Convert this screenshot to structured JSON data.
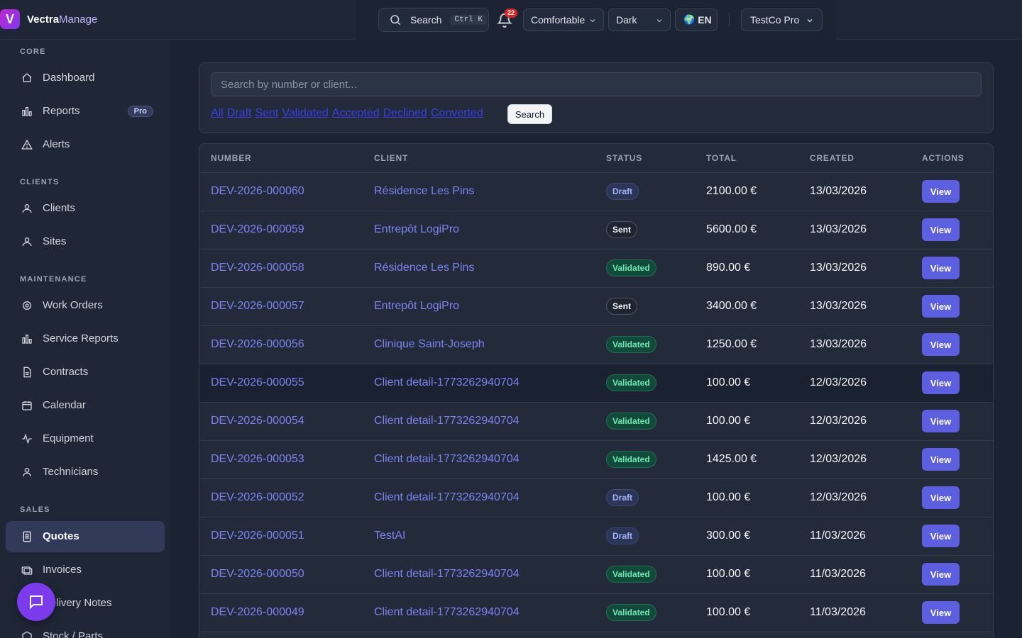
{
  "brand": {
    "logo_letter": "V",
    "name_a": "Vectra",
    "name_b": "Manage"
  },
  "topbar": {
    "search_label": "Search",
    "search_shortcut": "Ctrl K",
    "notifications_count": "22",
    "density": "Comfortable",
    "theme": "Dark",
    "language_flag": "🌍",
    "language": "EN",
    "organization": "TestCo Pro"
  },
  "sidebar": {
    "sections": [
      {
        "title": "CORE",
        "items": [
          {
            "label": "Dashboard",
            "icon": "home-icon"
          },
          {
            "label": "Reports",
            "icon": "bar-chart-icon",
            "badge": "Pro"
          },
          {
            "label": "Alerts",
            "icon": "alert-triangle-icon"
          }
        ]
      },
      {
        "title": "CLIENTS",
        "items": [
          {
            "label": "Clients",
            "icon": "users-icon"
          },
          {
            "label": "Sites",
            "icon": "users-icon"
          }
        ]
      },
      {
        "title": "MAINTENANCE",
        "items": [
          {
            "label": "Work Orders",
            "icon": "gear-icon"
          },
          {
            "label": "Service Reports",
            "icon": "bar-chart-icon"
          },
          {
            "label": "Contracts",
            "icon": "document-icon"
          },
          {
            "label": "Calendar",
            "icon": "calendar-icon"
          },
          {
            "label": "Equipment",
            "icon": "activity-icon"
          },
          {
            "label": "Technicians",
            "icon": "user-icon"
          }
        ]
      },
      {
        "title": "SALES",
        "items": [
          {
            "label": "Quotes",
            "icon": "receipt-icon",
            "active": true
          },
          {
            "label": "Invoices",
            "icon": "banknote-icon"
          },
          {
            "label": "Delivery Notes",
            "icon": "truck-icon"
          },
          {
            "label": "Stock / Parts",
            "icon": "box-icon"
          }
        ]
      }
    ]
  },
  "filters": {
    "placeholder": "Search by number or client...",
    "links": [
      "All",
      "Draft",
      "Sent",
      "Validated",
      "Accepted",
      "Declined",
      "Converted"
    ],
    "search_button": "Search"
  },
  "table": {
    "columns": [
      "NUMBER",
      "CLIENT",
      "STATUS",
      "TOTAL",
      "CREATED",
      "ACTIONS"
    ],
    "action_label": "View",
    "rows": [
      {
        "number": "DEV-2026-000060",
        "client": "Résidence Les Pins",
        "status": "Draft",
        "total": "2100.00 €",
        "created": "13/03/2026"
      },
      {
        "number": "DEV-2026-000059",
        "client": "Entrepôt LogiPro",
        "status": "Sent",
        "total": "5600.00 €",
        "created": "13/03/2026"
      },
      {
        "number": "DEV-2026-000058",
        "client": "Résidence Les Pins",
        "status": "Validated",
        "total": "890.00 €",
        "created": "13/03/2026"
      },
      {
        "number": "DEV-2026-000057",
        "client": "Entrepôt LogiPro",
        "status": "Sent",
        "total": "3400.00 €",
        "created": "13/03/2026"
      },
      {
        "number": "DEV-2026-000056",
        "client": "Clinique Saint-Joseph",
        "status": "Validated",
        "total": "1250.00 €",
        "created": "13/03/2026"
      },
      {
        "number": "DEV-2026-000055",
        "client": "Client detail-1773262940704",
        "status": "Validated",
        "total": "100.00 €",
        "created": "12/03/2026",
        "highlight": true
      },
      {
        "number": "DEV-2026-000054",
        "client": "Client detail-1773262940704",
        "status": "Validated",
        "total": "100.00 €",
        "created": "12/03/2026"
      },
      {
        "number": "DEV-2026-000053",
        "client": "Client detail-1773262940704",
        "status": "Validated",
        "total": "1425.00 €",
        "created": "12/03/2026"
      },
      {
        "number": "DEV-2026-000052",
        "client": "Client detail-1773262940704",
        "status": "Draft",
        "total": "100.00 €",
        "created": "12/03/2026"
      },
      {
        "number": "DEV-2026-000051",
        "client": "TestAI",
        "status": "Draft",
        "total": "300.00 €",
        "created": "11/03/2026"
      },
      {
        "number": "DEV-2026-000050",
        "client": "Client detail-1773262940704",
        "status": "Validated",
        "total": "100.00 €",
        "created": "11/03/2026"
      },
      {
        "number": "DEV-2026-000049",
        "client": "Client detail-1773262940704",
        "status": "Validated",
        "total": "100.00 €",
        "created": "11/03/2026"
      }
    ]
  },
  "colors": {
    "accent": "#5b5fe0",
    "link": "#7c83f0",
    "background": "#1b2231"
  }
}
